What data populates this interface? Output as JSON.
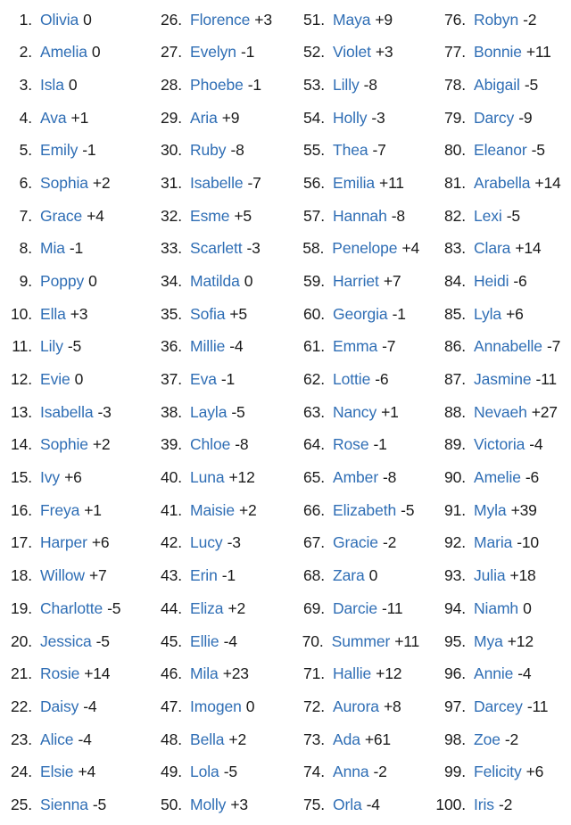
{
  "colors": {
    "name": "#2f6eb5",
    "rank": "#1b1b1b",
    "delta": "#1b1b1b",
    "background": "#ffffff"
  },
  "layout": {
    "columns": 4,
    "rows_per_column": 25,
    "total_entries": 100
  },
  "entries": [
    {
      "rank": "1.",
      "name": "Olivia",
      "delta": "0"
    },
    {
      "rank": "2.",
      "name": "Amelia",
      "delta": "0"
    },
    {
      "rank": "3.",
      "name": "Isla",
      "delta": "0"
    },
    {
      "rank": "4.",
      "name": "Ava",
      "delta": "+1"
    },
    {
      "rank": "5.",
      "name": "Emily",
      "delta": "-1"
    },
    {
      "rank": "6.",
      "name": "Sophia",
      "delta": "+2"
    },
    {
      "rank": "7.",
      "name": "Grace",
      "delta": "+4"
    },
    {
      "rank": "8.",
      "name": "Mia",
      "delta": "-1"
    },
    {
      "rank": "9.",
      "name": "Poppy",
      "delta": "0"
    },
    {
      "rank": "10.",
      "name": "Ella",
      "delta": "+3"
    },
    {
      "rank": "11.",
      "name": "Lily",
      "delta": "-5"
    },
    {
      "rank": "12.",
      "name": "Evie",
      "delta": "0"
    },
    {
      "rank": "13.",
      "name": "Isabella",
      "delta": "-3"
    },
    {
      "rank": "14.",
      "name": "Sophie",
      "delta": "+2"
    },
    {
      "rank": "15.",
      "name": "Ivy",
      "delta": "+6"
    },
    {
      "rank": "16.",
      "name": "Freya",
      "delta": "+1"
    },
    {
      "rank": "17.",
      "name": "Harper",
      "delta": "+6"
    },
    {
      "rank": "18.",
      "name": "Willow",
      "delta": "+7"
    },
    {
      "rank": "19.",
      "name": "Charlotte",
      "delta": "-5"
    },
    {
      "rank": "20.",
      "name": "Jessica",
      "delta": "-5"
    },
    {
      "rank": "21.",
      "name": "Rosie",
      "delta": "+14"
    },
    {
      "rank": "22.",
      "name": "Daisy",
      "delta": "-4"
    },
    {
      "rank": "23.",
      "name": "Alice",
      "delta": "-4"
    },
    {
      "rank": "24.",
      "name": "Elsie",
      "delta": "+4"
    },
    {
      "rank": "25.",
      "name": "Sienna",
      "delta": "-5"
    },
    {
      "rank": "26.",
      "name": "Florence",
      "delta": "+3"
    },
    {
      "rank": "27.",
      "name": "Evelyn",
      "delta": "-1"
    },
    {
      "rank": "28.",
      "name": "Phoebe",
      "delta": "-1"
    },
    {
      "rank": "29.",
      "name": "Aria",
      "delta": "+9"
    },
    {
      "rank": "30.",
      "name": "Ruby",
      "delta": "-8"
    },
    {
      "rank": "31.",
      "name": "Isabelle",
      "delta": "-7"
    },
    {
      "rank": "32.",
      "name": "Esme",
      "delta": "+5"
    },
    {
      "rank": "33.",
      "name": "Scarlett",
      "delta": "-3"
    },
    {
      "rank": "34.",
      "name": "Matilda",
      "delta": "0"
    },
    {
      "rank": "35.",
      "name": "Sofia",
      "delta": "+5"
    },
    {
      "rank": "36.",
      "name": "Millie",
      "delta": "-4"
    },
    {
      "rank": "37.",
      "name": "Eva",
      "delta": "-1"
    },
    {
      "rank": "38.",
      "name": "Layla",
      "delta": "-5"
    },
    {
      "rank": "39.",
      "name": "Chloe",
      "delta": "-8"
    },
    {
      "rank": "40.",
      "name": "Luna",
      "delta": "+12"
    },
    {
      "rank": "41.",
      "name": "Maisie",
      "delta": "+2"
    },
    {
      "rank": "42.",
      "name": "Lucy",
      "delta": "-3"
    },
    {
      "rank": "43.",
      "name": "Erin",
      "delta": "-1"
    },
    {
      "rank": "44.",
      "name": "Eliza",
      "delta": "+2"
    },
    {
      "rank": "45.",
      "name": "Ellie",
      "delta": "-4"
    },
    {
      "rank": "46.",
      "name": "Mila",
      "delta": "+23"
    },
    {
      "rank": "47.",
      "name": "Imogen",
      "delta": "0"
    },
    {
      "rank": "48.",
      "name": "Bella",
      "delta": "+2"
    },
    {
      "rank": "49.",
      "name": "Lola",
      "delta": "-5"
    },
    {
      "rank": "50.",
      "name": "Molly",
      "delta": "+3"
    },
    {
      "rank": "51.",
      "name": "Maya",
      "delta": "+9"
    },
    {
      "rank": "52.",
      "name": "Violet",
      "delta": "+3"
    },
    {
      "rank": "53.",
      "name": "Lilly",
      "delta": "-8"
    },
    {
      "rank": "54.",
      "name": "Holly",
      "delta": "-3"
    },
    {
      "rank": "55.",
      "name": "Thea",
      "delta": "-7"
    },
    {
      "rank": "56.",
      "name": "Emilia",
      "delta": "+11"
    },
    {
      "rank": "57.",
      "name": "Hannah",
      "delta": "-8"
    },
    {
      "rank": "58.",
      "name": "Penelope",
      "delta": "+4"
    },
    {
      "rank": "59.",
      "name": "Harriet",
      "delta": "+7"
    },
    {
      "rank": "60.",
      "name": "Georgia",
      "delta": "-1"
    },
    {
      "rank": "61.",
      "name": "Emma",
      "delta": "-7"
    },
    {
      "rank": "62.",
      "name": "Lottie",
      "delta": "-6"
    },
    {
      "rank": "63.",
      "name": "Nancy",
      "delta": "+1"
    },
    {
      "rank": "64.",
      "name": "Rose",
      "delta": "-1"
    },
    {
      "rank": "65.",
      "name": "Amber",
      "delta": "-8"
    },
    {
      "rank": "66.",
      "name": "Elizabeth",
      "delta": "-5"
    },
    {
      "rank": "67.",
      "name": "Gracie",
      "delta": "-2"
    },
    {
      "rank": "68.",
      "name": "Zara",
      "delta": "0"
    },
    {
      "rank": "69.",
      "name": "Darcie",
      "delta": "-11"
    },
    {
      "rank": "70.",
      "name": "Summer",
      "delta": "+11"
    },
    {
      "rank": "71.",
      "name": "Hallie",
      "delta": "+12"
    },
    {
      "rank": "72.",
      "name": "Aurora",
      "delta": "+8"
    },
    {
      "rank": "73.",
      "name": "Ada",
      "delta": "+61"
    },
    {
      "rank": "74.",
      "name": "Anna",
      "delta": "-2"
    },
    {
      "rank": "75.",
      "name": "Orla",
      "delta": "-4"
    },
    {
      "rank": "76.",
      "name": "Robyn",
      "delta": "-2"
    },
    {
      "rank": "77.",
      "name": "Bonnie",
      "delta": "+11"
    },
    {
      "rank": "78.",
      "name": "Abigail",
      "delta": "-5"
    },
    {
      "rank": "79.",
      "name": "Darcy",
      "delta": "-9"
    },
    {
      "rank": "80.",
      "name": "Eleanor",
      "delta": "-5"
    },
    {
      "rank": "81.",
      "name": "Arabella",
      "delta": "+14"
    },
    {
      "rank": "82.",
      "name": "Lexi",
      "delta": "-5"
    },
    {
      "rank": "83.",
      "name": "Clara",
      "delta": "+14"
    },
    {
      "rank": "84.",
      "name": "Heidi",
      "delta": "-6"
    },
    {
      "rank": "85.",
      "name": "Lyla",
      "delta": "+6"
    },
    {
      "rank": "86.",
      "name": "Annabelle",
      "delta": "-7"
    },
    {
      "rank": "87.",
      "name": "Jasmine",
      "delta": "-11"
    },
    {
      "rank": "88.",
      "name": "Nevaeh",
      "delta": "+27"
    },
    {
      "rank": "89.",
      "name": "Victoria",
      "delta": "-4"
    },
    {
      "rank": "90.",
      "name": "Amelie",
      "delta": "-6"
    },
    {
      "rank": "91.",
      "name": "Myla",
      "delta": "+39"
    },
    {
      "rank": "92.",
      "name": "Maria",
      "delta": "-10"
    },
    {
      "rank": "93.",
      "name": "Julia",
      "delta": "+18"
    },
    {
      "rank": "94.",
      "name": "Niamh",
      "delta": "0"
    },
    {
      "rank": "95.",
      "name": "Mya",
      "delta": "+12"
    },
    {
      "rank": "96.",
      "name": "Annie",
      "delta": "-4"
    },
    {
      "rank": "97.",
      "name": "Darcey",
      "delta": "-11"
    },
    {
      "rank": "98.",
      "name": "Zoe",
      "delta": "-2"
    },
    {
      "rank": "99.",
      "name": "Felicity",
      "delta": "+6"
    },
    {
      "rank": "100.",
      "name": "Iris",
      "delta": "-2"
    }
  ]
}
